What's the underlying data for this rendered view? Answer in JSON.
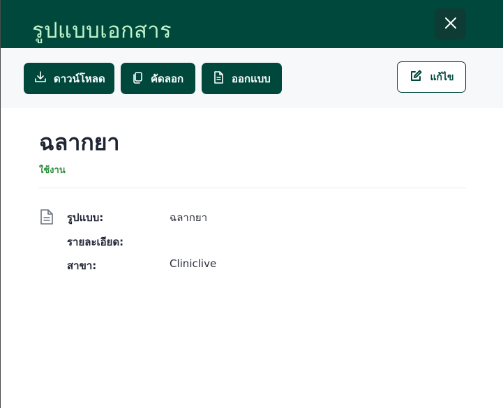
{
  "header": {
    "title": "รูปแบบเอกสาร",
    "close_icon": "close-icon",
    "background_color": "#00483c",
    "title_color": "#bff2c9"
  },
  "toolbar": {
    "download_label": "ดาวน์โหลด",
    "copy_label": "คัดลอก",
    "export_label": "ออกแบบ",
    "edit_label": "แก้ไข",
    "icons": {
      "download": "download-icon",
      "copy": "copy-icon",
      "export": "file-icon",
      "edit": "edit-icon"
    }
  },
  "document": {
    "title": "ฉลากยา",
    "status": "ใช้งาน",
    "status_color": "#2e8f3e"
  },
  "details": {
    "icon": "file-icon",
    "rows": [
      {
        "label": "รูปแบบ:",
        "value": "ฉลากยา"
      },
      {
        "label": "รายละเอียด:",
        "value": ""
      },
      {
        "label": "สาขา:",
        "value": "Cliniclive"
      }
    ]
  }
}
